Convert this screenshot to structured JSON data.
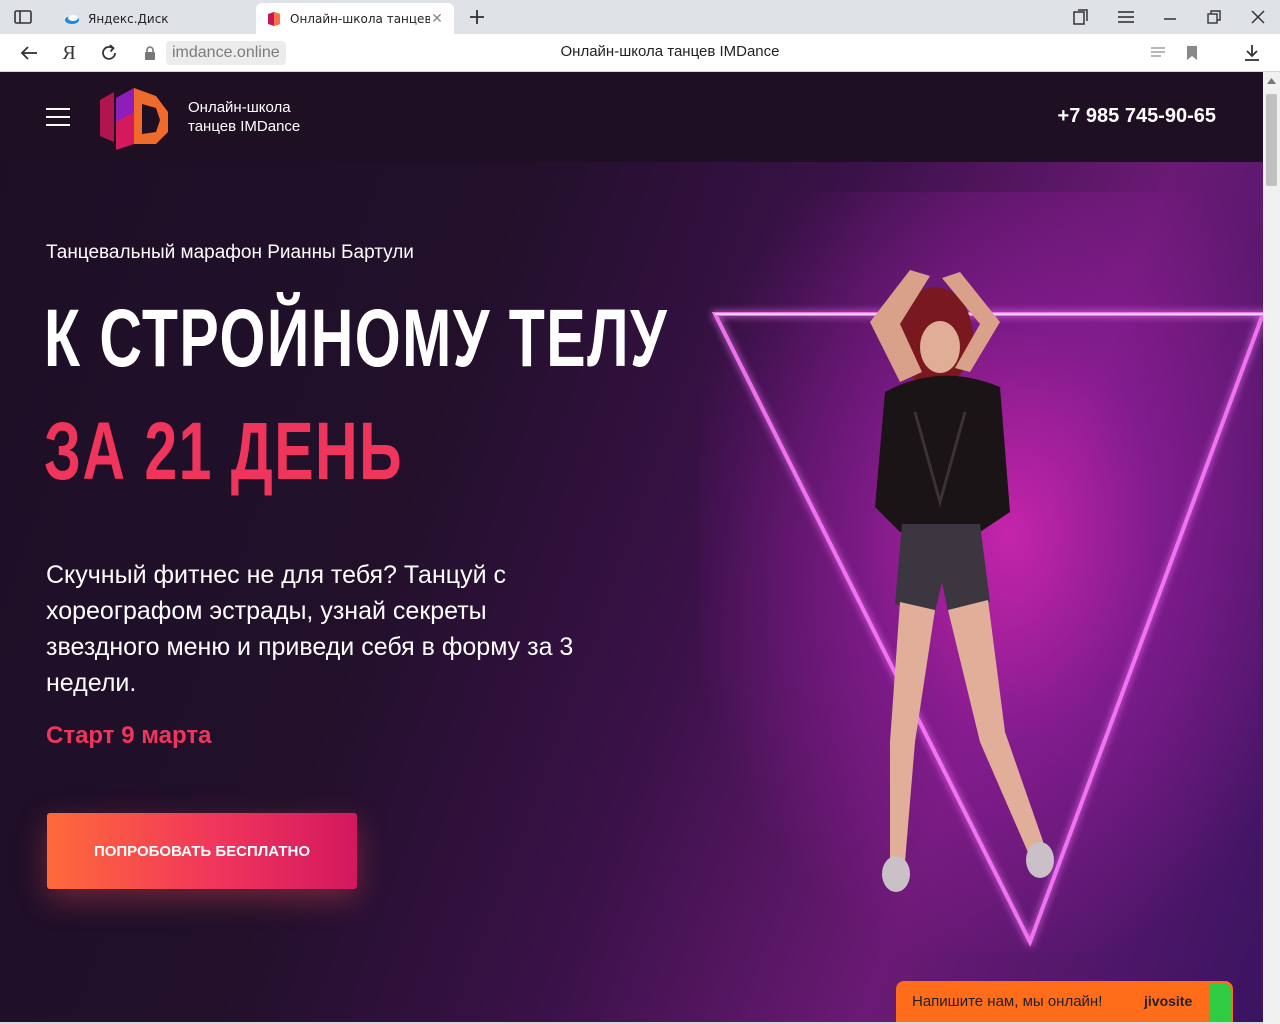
{
  "browser": {
    "tabs": [
      {
        "title": "Яндекс.Диск",
        "active": false
      },
      {
        "title": "Онлайн-школа танцев IM",
        "active": true
      }
    ],
    "address": {
      "url": "imdance.online",
      "page_title": "Онлайн-школа танцев IMDance",
      "yandex_label": "Я"
    }
  },
  "site": {
    "school_name": "Онлайн-школа танцев IMDance",
    "phone": "+7 985 745-90-65"
  },
  "hero": {
    "subtitle": "Танцевальный марафон Рианны Бартули",
    "headline_line1": "К СТРОЙНОМУ ТЕЛУ",
    "headline_line2": "ЗА 21 ДЕНЬ",
    "description": "Скучный фитнес не для тебя? Танцуй с хореографом эстрады, узнай секреты звездного меню и приведи себя в форму за 3 недели.",
    "start_date": "Старт 9 марта",
    "cta_label": "ПОПРОБОВАТЬ БЕСПЛАТНО"
  },
  "chat": {
    "prompt": "Напишите нам, мы онлайн!",
    "brand": "jivosite"
  },
  "colors": {
    "accent": "#f0355c",
    "header_bg": "#1f0f23",
    "chat_bg": "#ff6c1a"
  }
}
